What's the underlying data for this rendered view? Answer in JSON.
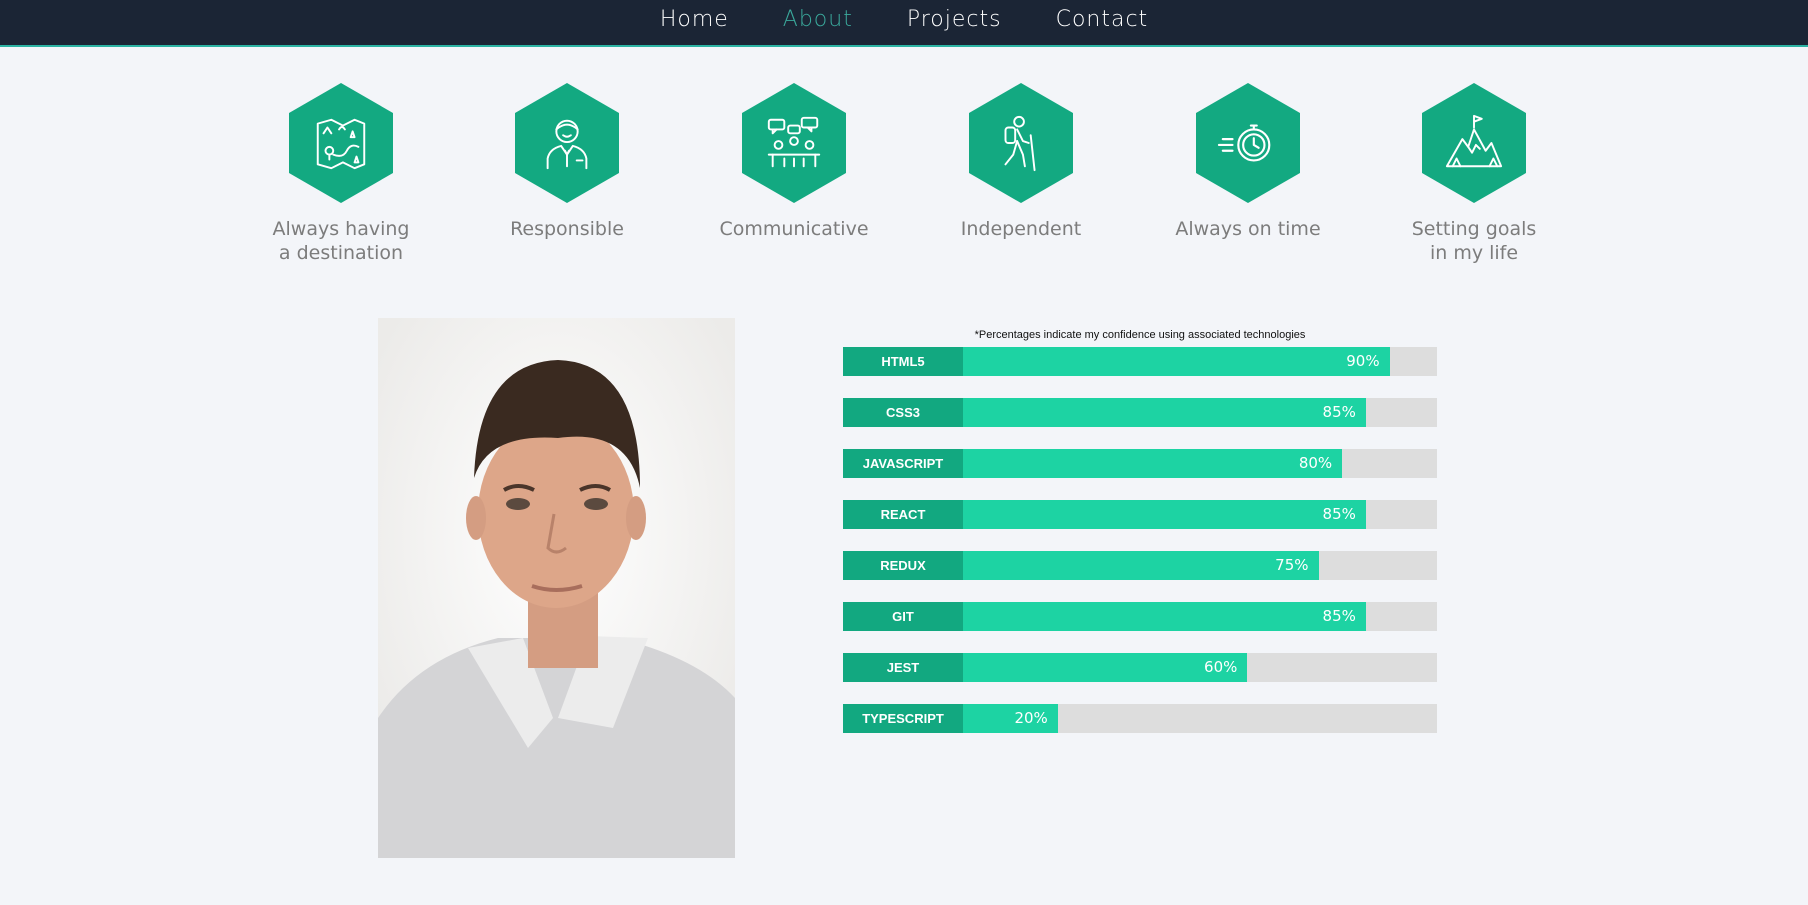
{
  "nav": {
    "items": [
      {
        "label": "Home",
        "active": false
      },
      {
        "label": "About",
        "active": true
      },
      {
        "label": "Projects",
        "active": false
      },
      {
        "label": "Contact",
        "active": false
      }
    ]
  },
  "qualities": [
    {
      "label": "Always having\na destination",
      "icon": "map-icon"
    },
    {
      "label": "Responsible",
      "icon": "businessman-icon"
    },
    {
      "label": "Communicative",
      "icon": "meeting-icon"
    },
    {
      "label": "Independent",
      "icon": "hiker-icon"
    },
    {
      "label": "Always on time",
      "icon": "stopwatch-icon"
    },
    {
      "label": "Setting goals\nin my life",
      "icon": "mountain-flag-icon"
    }
  ],
  "skills": {
    "note": "*Percentages indicate my confidence using associated technologies",
    "items": [
      {
        "name": "HTML5",
        "percent": 90,
        "label": "90%"
      },
      {
        "name": "CSS3",
        "percent": 85,
        "label": "85%"
      },
      {
        "name": "JAVASCRIPT",
        "percent": 80,
        "label": "80%"
      },
      {
        "name": "REACT",
        "percent": 85,
        "label": "85%"
      },
      {
        "name": "REDUX",
        "percent": 75,
        "label": "75%"
      },
      {
        "name": "GIT",
        "percent": 85,
        "label": "85%"
      },
      {
        "name": "JEST",
        "percent": 60,
        "label": "60%"
      },
      {
        "name": "TYPESCRIPT",
        "percent": 20,
        "label": "20%"
      }
    ]
  },
  "colors": {
    "nav_bg": "#1b2535",
    "accent": "#3aa99c",
    "hex": "#13a981",
    "bar_label": "#12a880",
    "bar_fill": "#1dd3a3",
    "bar_track": "#dddddd"
  }
}
